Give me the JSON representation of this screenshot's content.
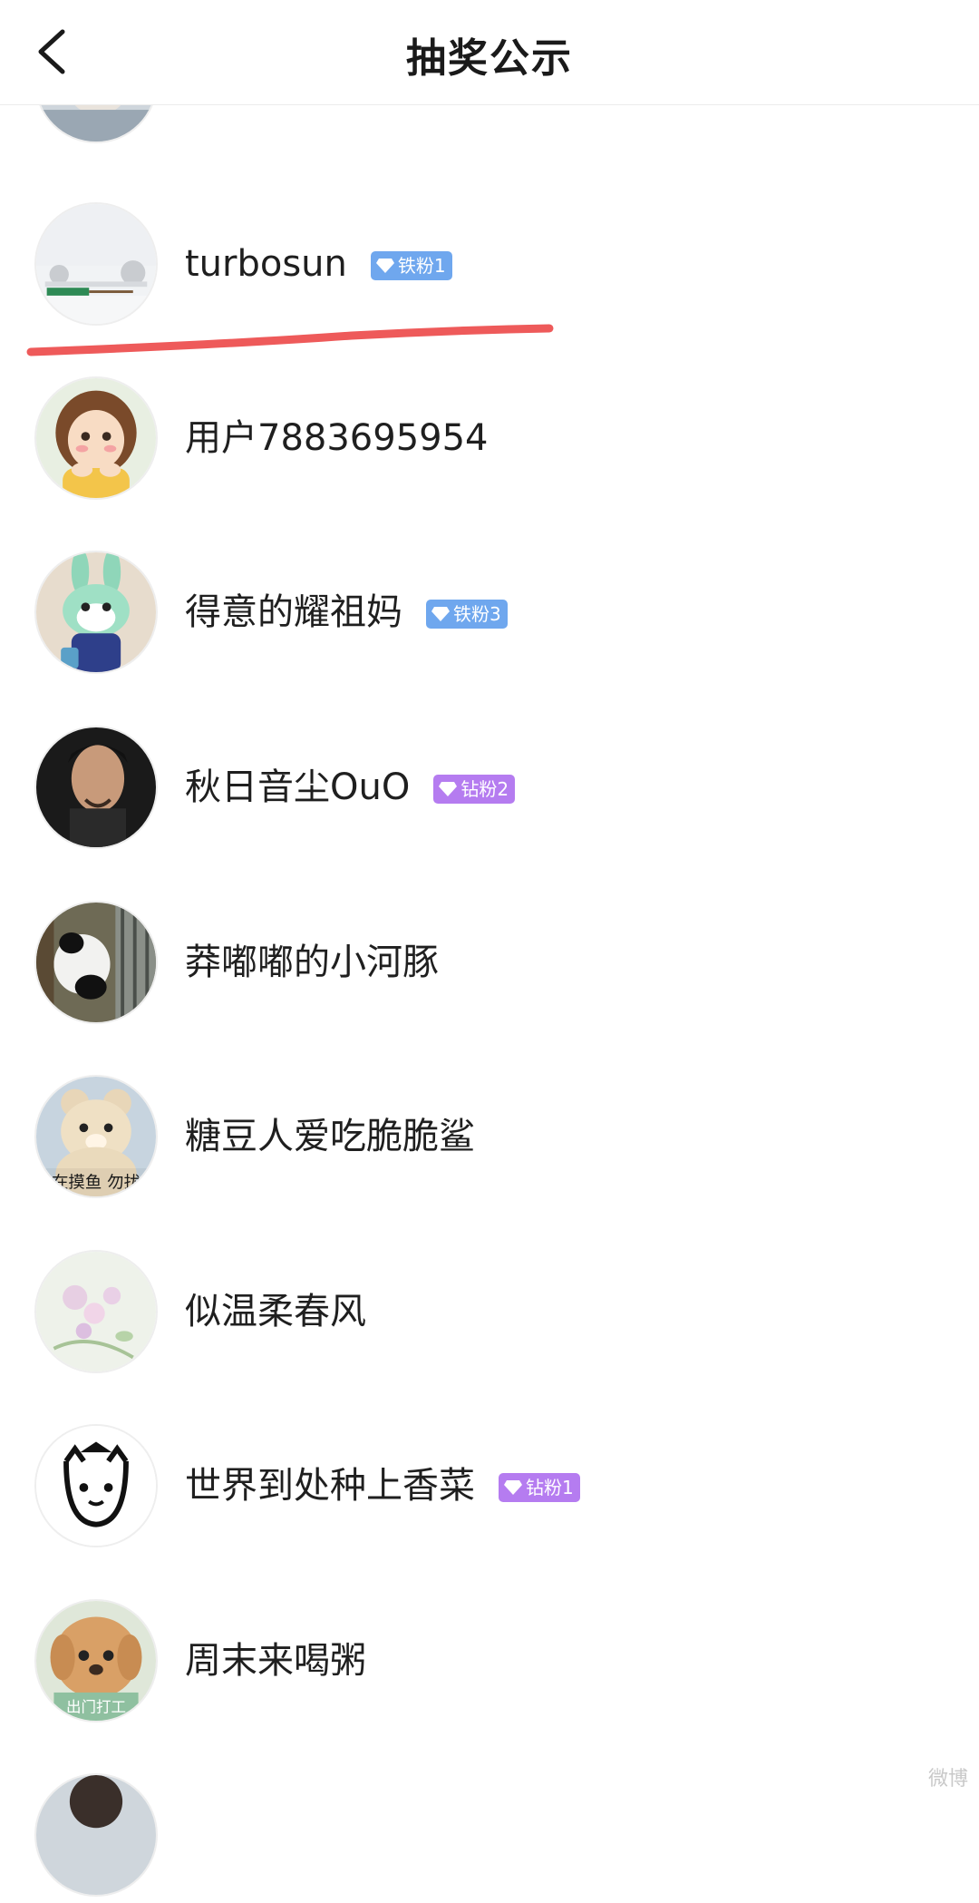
{
  "header": {
    "title": "抽奖公示",
    "back_icon": "chevron-left-icon"
  },
  "entries": [
    {
      "name": "",
      "badge": null,
      "avatar": "person-photo-partial"
    },
    {
      "name": "turbosun",
      "badge": {
        "text": "铁粉1",
        "color": "#6fa7ee"
      },
      "avatar": "snowy-landscape-photo"
    },
    {
      "name": "用户7883695954",
      "badge": null,
      "avatar": "cartoon-girl-avatar"
    },
    {
      "name": "得意的耀祖妈",
      "badge": {
        "text": "铁粉3",
        "color": "#6fa7ee"
      },
      "avatar": "cartoon-rabbit-avatar"
    },
    {
      "name": "秋日音尘OuO",
      "badge": {
        "text": "钻粉2",
        "color": "#b57cf0"
      },
      "avatar": "man-portrait-photo"
    },
    {
      "name": "莽嘟嘟的小河豚",
      "badge": null,
      "avatar": "panda-photo"
    },
    {
      "name": "糖豆人爱吃脆脆鲨",
      "badge": null,
      "avatar": "teddy-bear-photo"
    },
    {
      "name": "似温柔春风",
      "badge": null,
      "avatar": "pink-flowers-photo"
    },
    {
      "name": "世界到处种上香菜",
      "badge": {
        "text": "钻粉1",
        "color": "#b57cf0"
      },
      "avatar": "doodle-cat-avatar"
    },
    {
      "name": "周末来喝粥",
      "badge": null,
      "avatar": "plush-dog-photo"
    }
  ],
  "avatar_captions": {
    "teddy": "在摸鱼 勿扰",
    "dog": "出门打工"
  },
  "highlight": {
    "color": "#ee5a5a",
    "target": "turbosun"
  },
  "watermark": "微博"
}
